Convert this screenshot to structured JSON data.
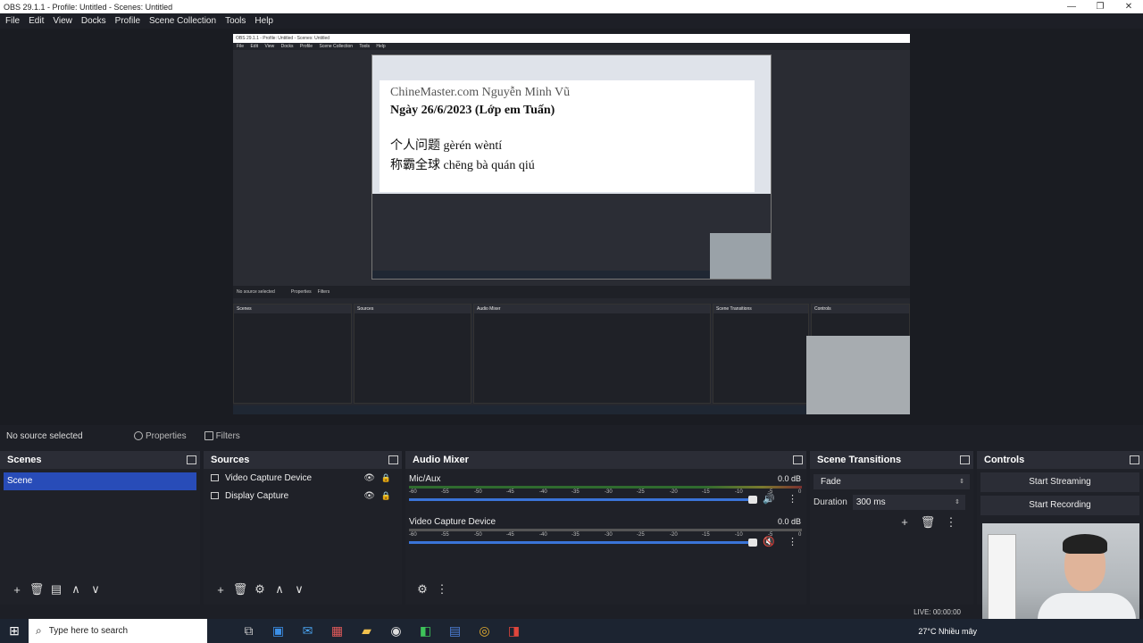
{
  "window": {
    "title": "OBS 29.1.1 - Profile: Untitled - Scenes: Untitled",
    "minimize": "—",
    "maximize": "❐",
    "close": "✕"
  },
  "menu": [
    "File",
    "Edit",
    "View",
    "Docks",
    "Profile",
    "Scene Collection",
    "Tools",
    "Help"
  ],
  "nested": {
    "title": "OBS 29.1.1 - Profile: Untitled - Scenes: Untitled",
    "menu": [
      "File",
      "Edit",
      "View",
      "Docks",
      "Profile",
      "Scene Collection",
      "Tools",
      "Help"
    ],
    "slide_line1": "ChineMaster.com Nguyễn Minh Vũ",
    "slide_line2": "Ngày 26/6/2023 (Lớp em Tuấn)",
    "slide_line3": "个人问题 gèrén wèntí",
    "slide_line4": "称霸全球 chēng bà quán qiú",
    "no_source": "No source selected",
    "props": "Properties",
    "filters": "Filters",
    "panels": [
      "Scenes",
      "Sources",
      "Audio Mixer",
      "Scene Transitions",
      "Controls"
    ]
  },
  "source_toolbar": {
    "no_source": "No source selected",
    "properties": "Properties",
    "filters": "Filters"
  },
  "scenes": {
    "header": "Scenes",
    "items": [
      "Scene"
    ]
  },
  "sources": {
    "header": "Sources",
    "items": [
      "Video Capture Device",
      "Display Capture"
    ]
  },
  "mixer": {
    "header": "Audio Mixer",
    "channels": [
      {
        "name": "Mic/Aux",
        "db": "0.0 dB"
      },
      {
        "name": "Video Capture Device",
        "db": "0.0 dB"
      }
    ],
    "scale": [
      "-60",
      "-55",
      "-50",
      "-45",
      "-40",
      "-35",
      "-30",
      "-25",
      "-20",
      "-15",
      "-10",
      "-5",
      "0"
    ]
  },
  "transitions": {
    "header": "Scene Transitions",
    "selected": "Fade",
    "duration_label": "Duration",
    "duration_value": "300 ms"
  },
  "controls": {
    "header": "Controls",
    "start_streaming": "Start Streaming",
    "start_recording": "Start Recording"
  },
  "status": {
    "live": "LIVE: 00:00:00"
  },
  "taskbar": {
    "search_placeholder": "Type here to search",
    "weather": "27°C  Nhiều mây"
  }
}
